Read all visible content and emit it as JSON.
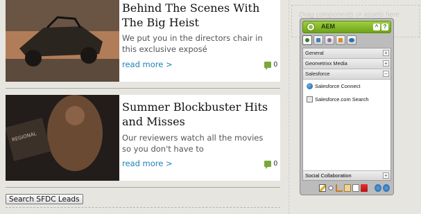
{
  "articles": [
    {
      "title": "Behind The Scenes With The Big Heist",
      "description": "We put you in the directors chair in this exclusive exposé",
      "read_more": "read more >",
      "comment_count": "0"
    },
    {
      "title": "Summer Blockbuster Hits and Misses",
      "description": "Our reviewers watch all the movies so you don't have to",
      "read_more": "read more >",
      "comment_count": "0"
    }
  ],
  "search_button": "Search SFDC Leads",
  "dropzone": "Drag components or assets here",
  "sidekick": {
    "title": "AEM",
    "collapse": "^",
    "help": "?",
    "groups": {
      "general": "General",
      "geometrixx_media": "Geometrixx Media",
      "salesforce": "Salesforce",
      "social_collaboration": "Social Collaboration"
    },
    "components": [
      "Salesforce Connect",
      "Salesforce.com Search"
    ],
    "toggle_plus": "+",
    "toggle_minus": "–"
  },
  "colors": {
    "accent_green": "#7aa73b",
    "link_blue": "#1a82b9",
    "page_bg": "#e6e5df"
  }
}
